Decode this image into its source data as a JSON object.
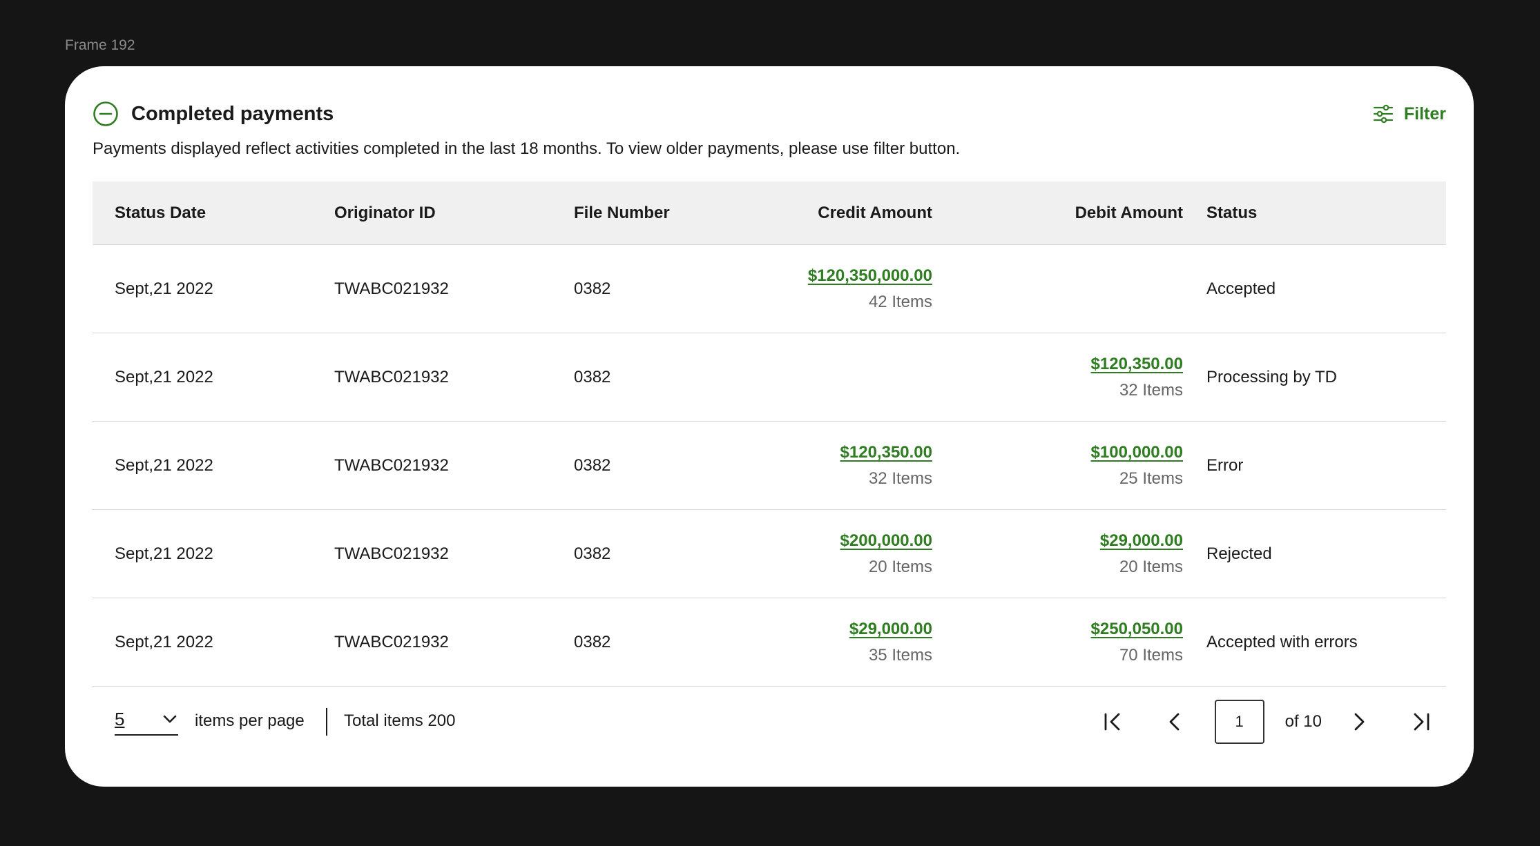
{
  "frame": {
    "label": "Frame 192"
  },
  "panel": {
    "title": "Completed payments",
    "filter_label": "Filter",
    "description": "Payments displayed reflect activities completed in the last 18 months. To view older payments, please use filter button."
  },
  "table": {
    "headers": {
      "status_date": "Status Date",
      "originator_id": "Originator ID",
      "file_number": "File Number",
      "credit_amount": "Credit Amount",
      "debit_amount": "Debit Amount",
      "status": "Status"
    },
    "rows": [
      {
        "date": "Sept,21 2022",
        "originator": "TWABC021932",
        "file": "0382",
        "credit": "$120,350,000.00",
        "credit_items": "42 Items",
        "debit": "",
        "debit_items": "",
        "status": "Accepted"
      },
      {
        "date": "Sept,21 2022",
        "originator": "TWABC021932",
        "file": "0382",
        "credit": "",
        "credit_items": "",
        "debit": "$120,350.00",
        "debit_items": "32 Items",
        "status": "Processing by TD"
      },
      {
        "date": "Sept,21 2022",
        "originator": "TWABC021932",
        "file": "0382",
        "credit": "$120,350.00",
        "credit_items": "32 Items",
        "debit": "$100,000.00",
        "debit_items": "25 Items",
        "status": "Error"
      },
      {
        "date": "Sept,21 2022",
        "originator": "TWABC021932",
        "file": "0382",
        "credit": "$200,000.00",
        "credit_items": "20 Items",
        "debit": "$29,000.00",
        "debit_items": "20 Items",
        "status": "Rejected"
      },
      {
        "date": "Sept,21 2022",
        "originator": "TWABC021932",
        "file": "0382",
        "credit": "$29,000.00",
        "credit_items": "35 Items",
        "debit": "$250,050.00",
        "debit_items": "70 Items",
        "status": "Accepted with errors"
      }
    ]
  },
  "pagination": {
    "per_page_value": "5",
    "per_page_label": "items per page",
    "total_label": "Total items 200",
    "current_page": "1",
    "of_label": "of 10"
  },
  "colors": {
    "accent": "#2e7d20",
    "header_bg": "#f0f0f0",
    "background": "#151515"
  },
  "icons": [
    "collapse-circle-icon",
    "filter-sliders-icon",
    "chevron-down-icon",
    "first-page-icon",
    "prev-page-icon",
    "next-page-icon",
    "last-page-icon"
  ]
}
